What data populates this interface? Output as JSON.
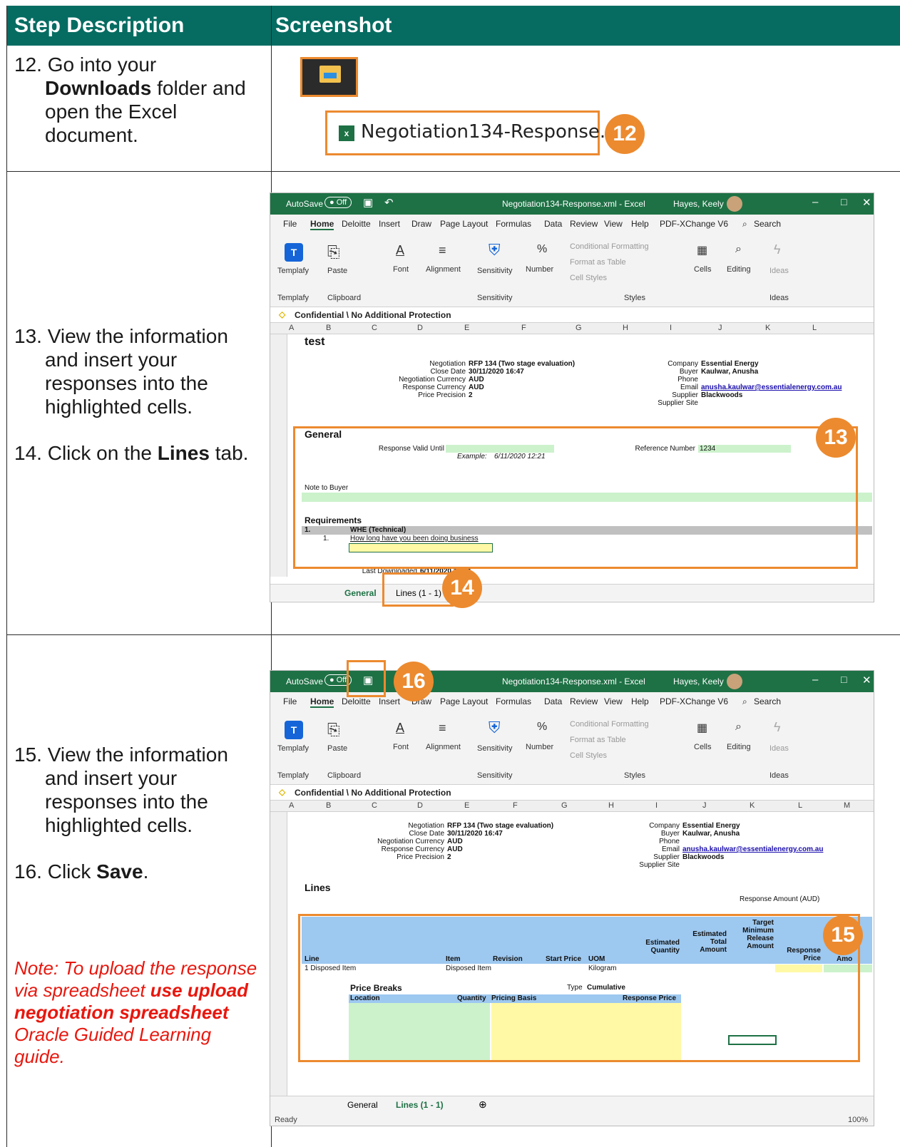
{
  "header": {
    "col1": "Step Description",
    "col2": "Screenshot"
  },
  "steps": {
    "s12": {
      "num": "12.",
      "pre": "Go into your",
      "bold": "Downloads",
      "post1": " folder and",
      "post2": "open the Excel",
      "post3": "document."
    },
    "s13": {
      "num": "13.",
      "l1": "View the information",
      "l2": "and insert your",
      "l3": "responses into the",
      "l4": "highlighted cells."
    },
    "s14": {
      "num": "14.",
      "pre": "Click on the ",
      "bold": "Lines",
      "post": " tab."
    },
    "s15": {
      "num": "15.",
      "l1": "View the information",
      "l2": "and insert your",
      "l3": "responses into the",
      "l4": "highlighted cells."
    },
    "s16": {
      "num": "16.",
      "pre": "Click ",
      "bold": "Save",
      "post": "."
    }
  },
  "note": {
    "l1": "Note: To upload the response",
    "l2": "via spreadsheet ",
    "b1": "use upload",
    "b2": "negotiation spreadsheet",
    "l3": "Oracle Guided Learning",
    "l4": "guide."
  },
  "file": {
    "name": "Negotiation134-Response.xml"
  },
  "badges": {
    "b12": "12",
    "b13": "13",
    "b14": "14",
    "b15": "15",
    "b16": "16"
  },
  "excel": {
    "autosave": "AutoSave",
    "off": "Off",
    "title": "Negotiation134-Response.xml - Excel",
    "user": "Hayes, Keely",
    "menu": [
      "File",
      "Home",
      "Deloitte",
      "Insert",
      "Draw",
      "Page Layout",
      "Formulas",
      "Data",
      "Review",
      "View",
      "Help",
      "PDF-XChange V6"
    ],
    "search": "Search",
    "ribbon": {
      "templafy": "Templafy",
      "paste": "Paste",
      "font": "Font",
      "alignment": "Alignment",
      "sensitivity": "Sensitivity",
      "number": "Number",
      "cond": "Conditional Formatting",
      "fmt_table": "Format as Table",
      "cell_styles": "Cell Styles",
      "cells": "Cells",
      "editing": "Editing",
      "ideas": "Ideas",
      "grp_templafy": "Templafy",
      "grp_clipboard": "Clipboard",
      "grp_sensitivity": "Sensitivity",
      "grp_styles": "Styles",
      "grp_ideas": "Ideas"
    },
    "confidential": "Confidential \\ No Additional Protection",
    "cols1": [
      "A",
      "B",
      "C",
      "D",
      "E",
      "F",
      "G",
      "H",
      "I",
      "J",
      "K",
      "L"
    ],
    "cols2": [
      "A",
      "B",
      "C",
      "D",
      "E",
      "F",
      "G",
      "H",
      "I",
      "J",
      "K",
      "L",
      "M"
    ],
    "s1": {
      "r1_title": "test",
      "negotiation_lbl": "Negotiation",
      "negotiation_val": "RFP 134 (Two stage evaluation)",
      "close_lbl": "Close Date",
      "close_val": "30/11/2020 16:47",
      "neg_cur_lbl": "Negotiation Currency",
      "neg_cur_val": "AUD",
      "resp_cur_lbl": "Response Currency",
      "resp_cur_val": "AUD",
      "price_lbl": "Price Precision",
      "price_val": "2",
      "company_lbl": "Company",
      "company_val": "Essential Energy",
      "buyer_lbl": "Buyer",
      "buyer_val": "Kaulwar, Anusha",
      "phone_lbl": "Phone",
      "email_lbl": "Email",
      "email_val": "anusha.kaulwar@essentialenergy.com.au",
      "supplier_lbl": "Supplier",
      "supplier_val": "Blackwoods",
      "site_lbl": "Supplier Site",
      "general": "General",
      "valid_lbl": "Response Valid Until",
      "ref_lbl": "Reference Number",
      "ref_val": "1234",
      "example_lbl": "Example:",
      "example_val": "6/11/2020 12:21",
      "note_lbl": "Note to Buyer",
      "req": "Requirements",
      "r19_a": "1.",
      "r19_b": "WHE (Technical)",
      "r20_a": "1.",
      "r20_b": "How long have you been doing business",
      "last_lbl": "Last Downloaded",
      "last_val": "6/11/2020 12:21",
      "tab_general": "General",
      "tab_lines": "Lines (1 - 1)"
    },
    "s2": {
      "lines": "Lines",
      "resp_amt": "Response Amount (AUD)",
      "h_line": "Line",
      "h_item": "Item",
      "h_rev": "Revision",
      "h_start": "Start Price",
      "h_uom": "UOM",
      "h_estq": "Estimated Quantity",
      "h_esttot": "Estimated Total Amount",
      "h_target": "Target Minimum Release Amount",
      "h_resp": "Response Price",
      "h_amo": "Amo",
      "r14_line": "1 Disposed Item",
      "r14_item": "Disposed Item",
      "r14_uom": "Kilogram",
      "pb": "Price Breaks",
      "type_lbl": "Type",
      "type_val": "Cumulative",
      "h_loc": "Location",
      "h_qty": "Quantity",
      "h_pb": "Pricing Basis",
      "h_rp": "Response Price",
      "ready": "Ready",
      "zoom": "100%"
    }
  }
}
